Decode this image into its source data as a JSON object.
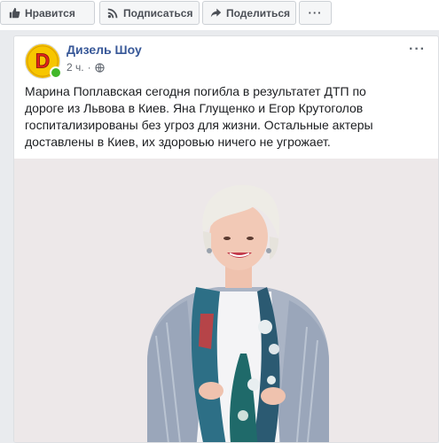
{
  "toolbar": {
    "like_label": "Нравится",
    "subscribe_label": "Подписаться",
    "share_label": "Поделиться",
    "more_label": "···"
  },
  "post": {
    "page_name": "Дизель Шоу",
    "time": "2 ч.",
    "separator": "·",
    "privacy_icon": "globe-icon",
    "more_label": "···",
    "text": "Марина Поплавская сегодня погибла в результатет ДТП по дороге из Львова в Киев. Яна Глущенко и Егор Крутоголов госпитализированы без угроз для жизни. Остальные актеры доставлены в Киев, их здоровью ничего не угрожает.",
    "avatar_letter": "D"
  },
  "colors": {
    "link": "#385898",
    "online": "#42b72a",
    "avatar_yellow": "#f7c600",
    "avatar_red": "#e2231a"
  }
}
